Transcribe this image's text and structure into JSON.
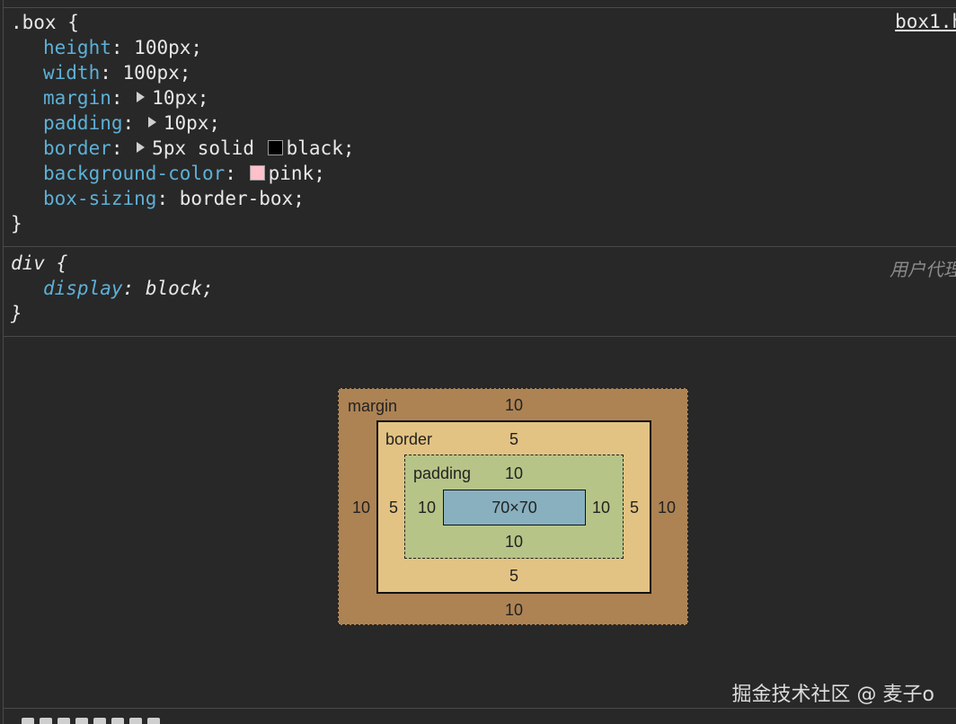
{
  "rule1": {
    "selector": ".box",
    "source": "box1.h",
    "declarations": [
      {
        "prop": "height",
        "value": "100px"
      },
      {
        "prop": "width",
        "value": "100px"
      },
      {
        "prop": "margin",
        "value": "10px"
      },
      {
        "prop": "padding",
        "value": "10px"
      },
      {
        "prop": "border",
        "value": "5px solid",
        "value2": "black"
      },
      {
        "prop": "background-color",
        "value": "pink"
      },
      {
        "prop": "box-sizing",
        "value": "border-box"
      }
    ],
    "swatch_border": "#000000",
    "swatch_bg": "#ffc0cb"
  },
  "rule2": {
    "selector": "div",
    "source": "用户代理",
    "declarations": [
      {
        "prop": "display",
        "value": "block"
      }
    ]
  },
  "punct": {
    "open": " {",
    "close": "}",
    "colon": ":",
    "semi": ";"
  },
  "box_model": {
    "margin_label": "margin",
    "border_label": "border",
    "padding_label": "padding",
    "margin": {
      "top": "10",
      "right": "10",
      "bottom": "10",
      "left": "10"
    },
    "border": {
      "top": "5",
      "right": "5",
      "bottom": "5",
      "left": "5"
    },
    "padding": {
      "top": "10",
      "right": "10",
      "bottom": "10",
      "left": "10"
    },
    "content": "70×70",
    "colors": {
      "margin": "#ad8354",
      "border": "#e3c383",
      "padding": "#b6c487",
      "content": "#88b0bf"
    }
  },
  "watermark": "掘金技术社区 @ 麦子o"
}
